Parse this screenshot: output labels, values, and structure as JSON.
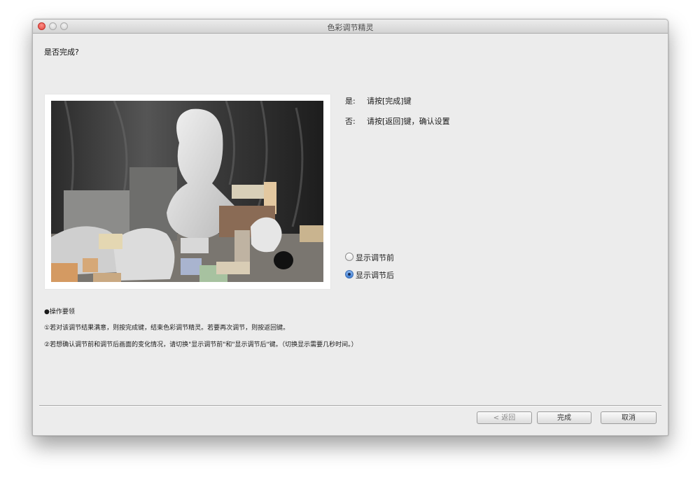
{
  "window": {
    "title": "色彩调节精灵"
  },
  "heading": "是否完成?",
  "answers": [
    {
      "key": "是:",
      "text": "请按[完成]键"
    },
    {
      "key": "否:",
      "text": "请按[返回]键，确认设置"
    }
  ],
  "view_options": [
    {
      "label": "显示调节前",
      "checked": false
    },
    {
      "label": "显示调节后",
      "checked": true
    }
  ],
  "notes": {
    "title": "●操作要领",
    "line1": "①若对该调节结果满意，则按完成键，结束色彩调节精灵。若要再次调节，则按返回键。",
    "line2": "②若想确认调节前和调节后画面的变化情况，请切换\"显示调节前\"和\"显示调节后\"键。（切换显示需要几秒时间。）"
  },
  "buttons": {
    "back": "< 返回",
    "finish": "完成",
    "cancel": "取消"
  },
  "colors": {
    "window_bg": "#ececec",
    "radio_selected": "#3f7fd4"
  }
}
